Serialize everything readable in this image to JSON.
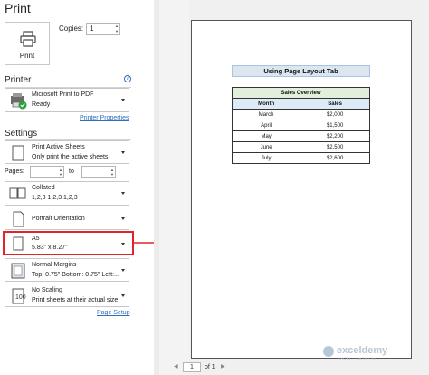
{
  "title": "Print",
  "print_button": {
    "label": "Print",
    "icon": "printer-icon"
  },
  "copies": {
    "label": "Copies:",
    "value": "1"
  },
  "printer": {
    "section_title": "Printer",
    "name": "Microsoft Print to PDF",
    "status": "Ready",
    "properties_link": "Printer Properties"
  },
  "settings": {
    "section_title": "Settings",
    "print_what": {
      "line1": "Print Active Sheets",
      "line2": "Only print the active sheets"
    },
    "pages": {
      "label": "Pages:",
      "from": "",
      "to_label": "to",
      "to": ""
    },
    "collation": {
      "line1": "Collated",
      "line2": "1,2,3    1,2,3    1,2,3"
    },
    "orientation": {
      "line1": "Portrait Orientation"
    },
    "paper_size": {
      "line1": "A5",
      "line2": "5.83\" x 8.27\""
    },
    "margins": {
      "line1": "Normal Margins",
      "line2": "Top: 0.75\" Bottom: 0.75\" Left:..."
    },
    "scaling": {
      "line1": "No Scaling",
      "line2": "Print sheets at their actual size"
    },
    "page_setup_link": "Page Setup"
  },
  "preview": {
    "sheet_title": "Using Page Layout Tab",
    "table_title": "Sales Overview",
    "headers": [
      "Month",
      "Sales"
    ],
    "rows": [
      [
        "March",
        "$2,000"
      ],
      [
        "April",
        "$1,500"
      ],
      [
        "May",
        "$2,200"
      ],
      [
        "June",
        "$2,500"
      ],
      [
        "July",
        "$2,600"
      ]
    ]
  },
  "pager": {
    "current": "1",
    "of_label": "of 1"
  },
  "watermark": {
    "name": "exceldemy",
    "tagline": "EXCEL · DATA · BI"
  },
  "colors": {
    "highlight": "#e0252a",
    "link": "#2f6fbd",
    "table_header": "#ddebf7",
    "table_overview": "#e2efda"
  }
}
